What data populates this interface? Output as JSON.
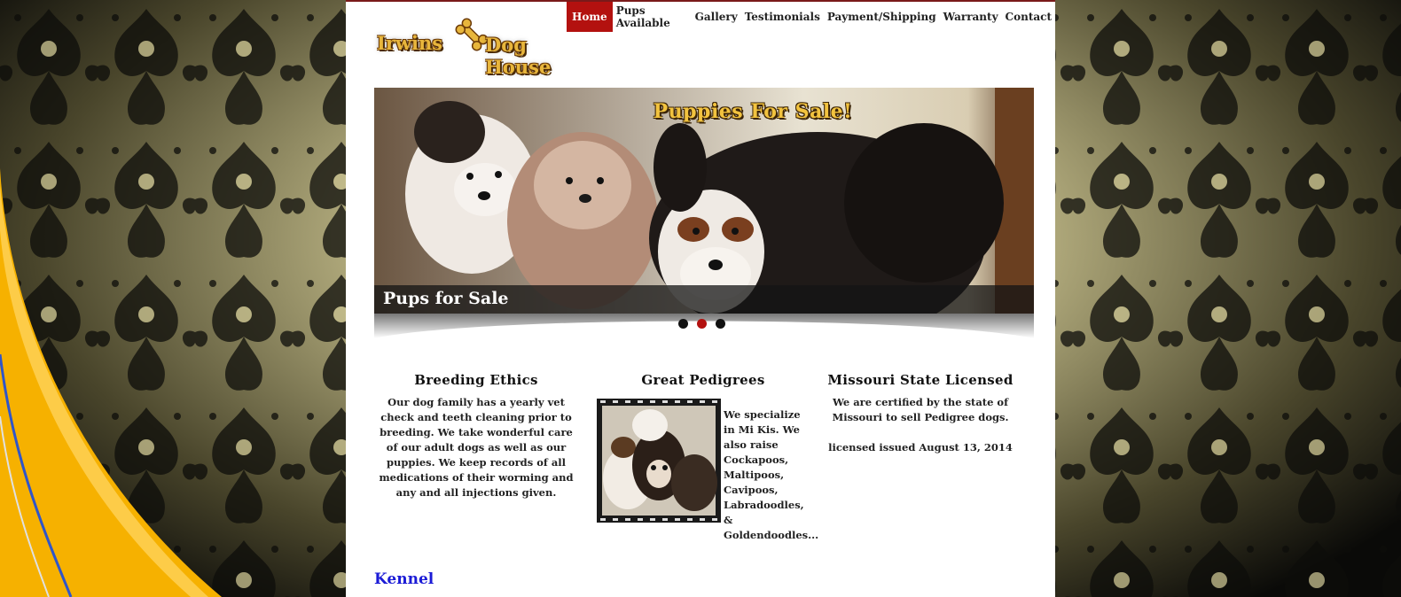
{
  "logo": {
    "left": "Irwins",
    "right": "Dog House",
    "icon": "bone-icon"
  },
  "nav": {
    "items": [
      "Home",
      "Pups Available",
      "Gallery",
      "Testimonials",
      "Payment/Shipping",
      "Warranty",
      "Contact"
    ],
    "active": "Home"
  },
  "slider": {
    "headline": "Puppies For Sale!",
    "caption": "Pups for Sale",
    "dots": 3,
    "active_dot": 2
  },
  "columns": {
    "breeding": {
      "title": "Breeding Ethics",
      "text": "Our dog family has a yearly vet check and teeth cleaning prior to breeding. We take wonderful care of our adult dogs as well as our puppies. We keep records of all medications of their worming and any and all injections given."
    },
    "pedigrees": {
      "title": "Great Pedigrees",
      "text": "We specialize in Mi Kis. We also raise Cockapoos, Maltipoos, Cavipoos, Labradoodles, & Goldendoodles..."
    },
    "licensed": {
      "title": "Missouri State Licensed",
      "text1": "We are certified by the state of Missouri to sell Pedigree dogs.",
      "text2": "licensed issued August 13, 2014"
    }
  },
  "kennel": "Kennel",
  "colors": {
    "accent": "#b3110f",
    "gold": "#e8b63c",
    "link": "#1b1bd6"
  }
}
